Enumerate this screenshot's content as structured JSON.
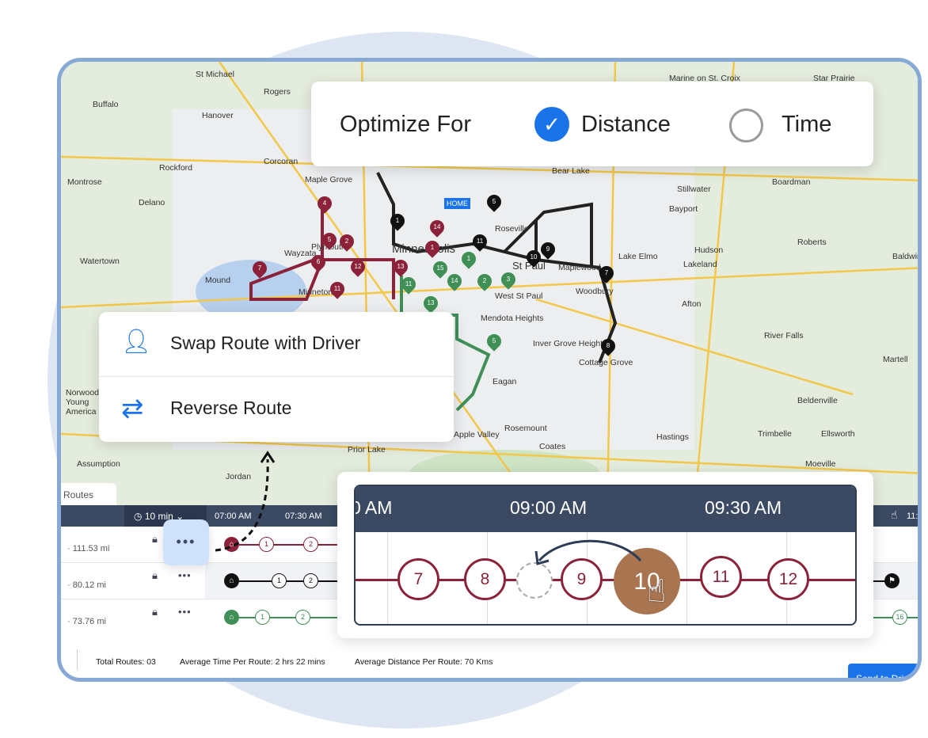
{
  "optimize": {
    "title": "Optimize For",
    "options": [
      {
        "label": "Distance",
        "selected": true
      },
      {
        "label": "Time",
        "selected": false
      }
    ]
  },
  "menu": {
    "items": [
      {
        "label": "Swap Route with Driver",
        "icon": "swap-user-icon"
      },
      {
        "label": "Reverse Route",
        "icon": "reverse-arrows-icon"
      }
    ]
  },
  "map": {
    "places": [
      "St Michael",
      "Rogers",
      "Buffalo",
      "Hanover",
      "Corcoran",
      "Rockford",
      "Maple Grove",
      "Montrose",
      "Delano",
      "Plymouth",
      "Wayzata",
      "Watertown",
      "Mound",
      "Minnetonka",
      "Minneapolis",
      "Roseville",
      "St Paul",
      "Maplewood",
      "Woodbury",
      "West St Paul",
      "Mendota Heights",
      "Inver Grove Heights",
      "Eagan",
      "Cottage Grove",
      "Apple Valley",
      "Rosemount",
      "Coates",
      "Prior Lake",
      "Hastings",
      "Lake Elmo",
      "Stillwater",
      "Bayport",
      "Afton",
      "Lakeland",
      "Hudson",
      "Roberts",
      "Baldwin",
      "River Falls",
      "Martell",
      "Ellsworth",
      "Beldenville",
      "Trimbelle",
      "Moeville",
      "Marine on St. Croix",
      "Star Prairie",
      "Boardman",
      "Norwood Young America",
      "Jordan",
      "Assumption",
      "Bear Lake",
      "HOME"
    ],
    "route_colors": {
      "red": "#8c2239",
      "black": "#111111",
      "green": "#3f8f57"
    }
  },
  "routes_tab": "Routes",
  "schedule": {
    "interval": "10 min",
    "times": [
      "07:00 AM",
      "07:30 AM",
      "11:"
    ],
    "rows": [
      {
        "distance": "111.53 mi",
        "color": "#8c2239",
        "stops": [
          "1",
          "2"
        ]
      },
      {
        "distance": "80.12 mi",
        "color": "#111111",
        "stops": [
          "1",
          "2"
        ]
      },
      {
        "distance": "73.76 mi",
        "color": "#3f8f57",
        "stops": [
          "1",
          "2",
          "16"
        ]
      }
    ]
  },
  "timeline": {
    "times": [
      "0 AM",
      "09:00 AM",
      "09:30 AM"
    ],
    "stops": [
      "7",
      "8",
      "9",
      "10",
      "11",
      "12"
    ],
    "dragging": "10"
  },
  "footer": {
    "total_routes_label": "Total Routes:",
    "total_routes": "03",
    "avg_time_label": "Average Time Per Route:",
    "avg_time": "2 hrs 22 mins",
    "avg_dist_label": "Average Distance Per Route:",
    "avg_dist": "70 Kms",
    "send_button": "Send to Drive"
  }
}
